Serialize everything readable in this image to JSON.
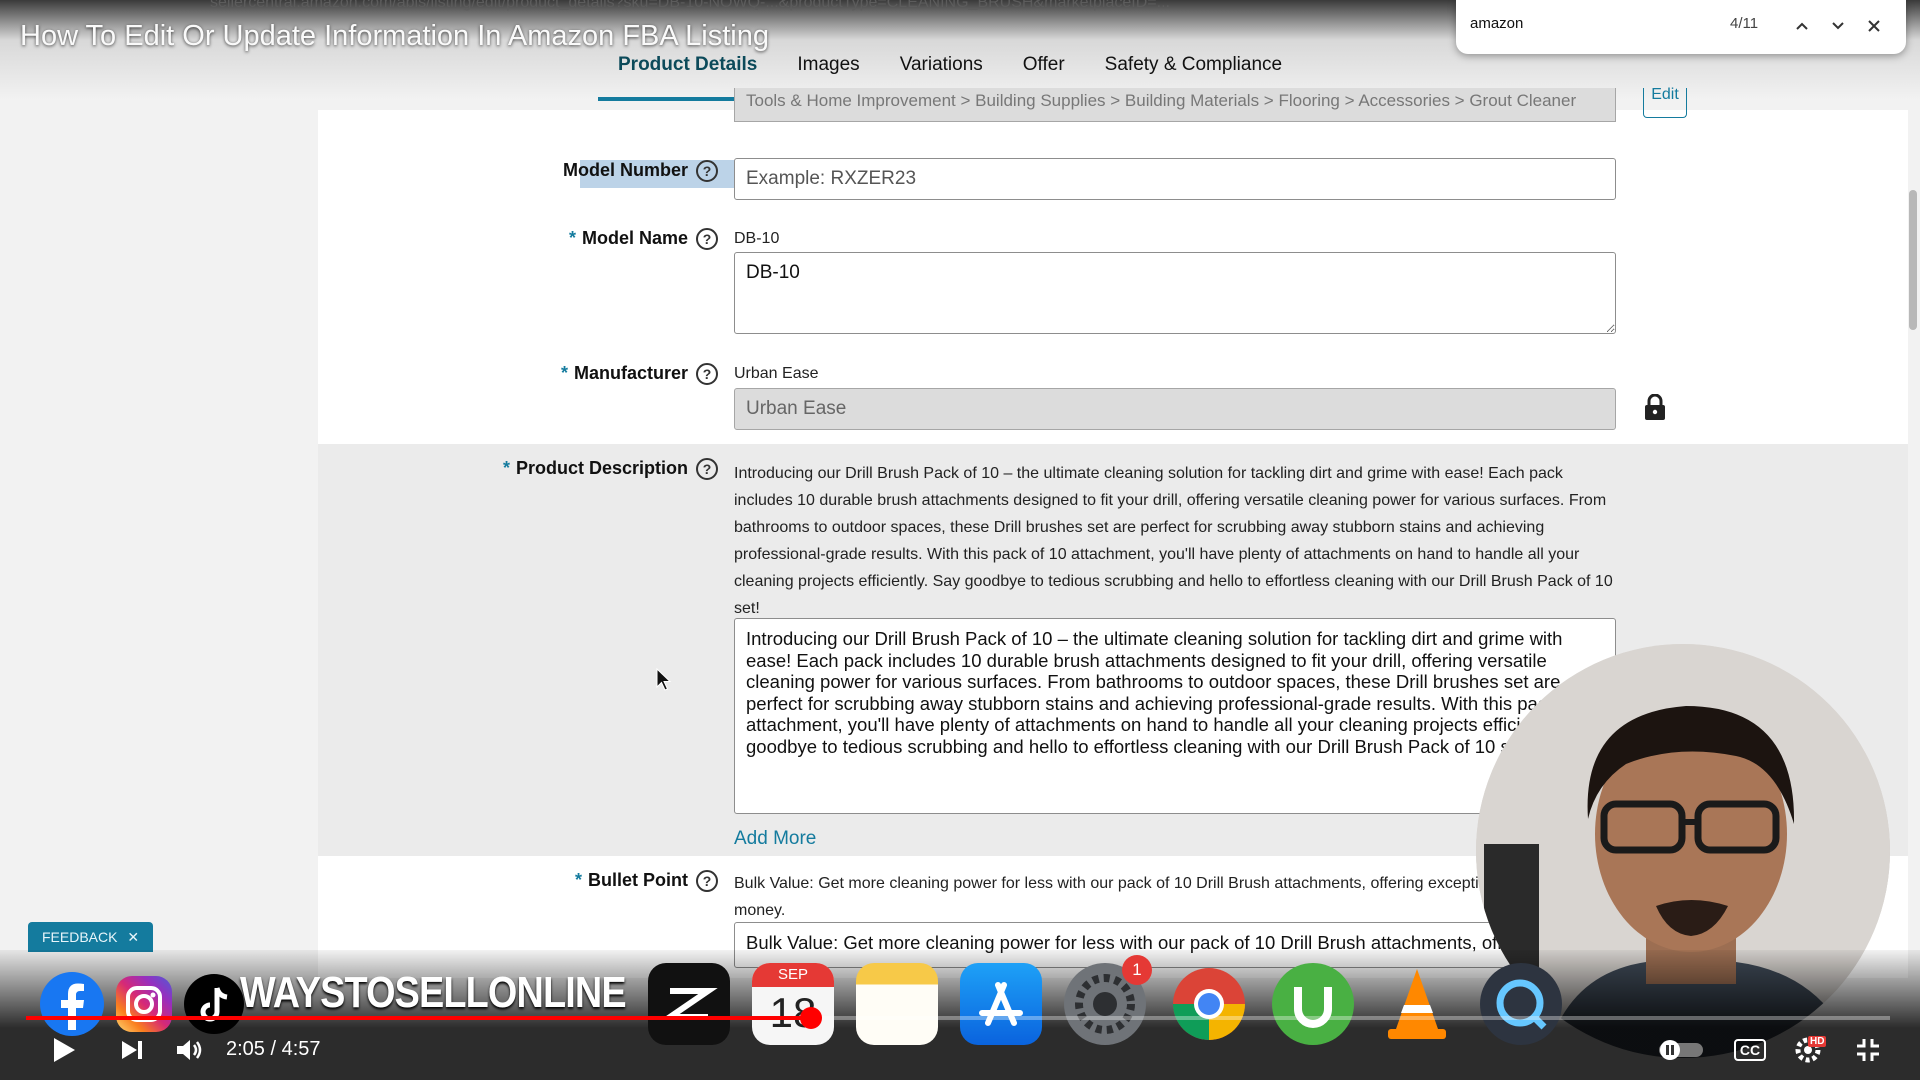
{
  "browser": {
    "url": "sellercentral.amazon.com/abis/listing/edit/product_details?sku=DB-10-NOWQ-...&productType=CLEANING_BRUSH&marketplaceID=..."
  },
  "video": {
    "title": "How To Edit Or Update Information In Amazon FBA Listing",
    "current_time": "2:05",
    "duration": "4:57",
    "time_display": "2:05 / 4:57",
    "progress": 0.4209
  },
  "find_bar": {
    "query": "amazon",
    "match_count": "4/11"
  },
  "tabs": [
    {
      "label": "Product Details",
      "active": true
    },
    {
      "label": "Images",
      "active": false
    },
    {
      "label": "Variations",
      "active": false
    },
    {
      "label": "Offer",
      "active": false
    },
    {
      "label": "Safety & Compliance",
      "active": false
    }
  ],
  "category": {
    "path": "Tools & Home Improvement > Building Supplies > Building Materials > Flooring > Accessories > Grout Cleaner",
    "edit_label": "Edit"
  },
  "form": {
    "model_number": {
      "label": "Model Number",
      "required": false,
      "placeholder": "Example: RXZER23",
      "value": ""
    },
    "model_name": {
      "label": "Model Name",
      "required": true,
      "caption": "DB-10",
      "value": "DB-10"
    },
    "manufacturer": {
      "label": "Manufacturer",
      "required": true,
      "caption": "Urban Ease",
      "value": "Urban Ease",
      "locked": true
    },
    "product_description": {
      "label": "Product Description",
      "required": true,
      "caption": "Introducing our Drill Brush Pack of 10 – the ultimate cleaning solution for tackling dirt and grime with ease! Each pack includes 10 durable brush attachments designed to fit your drill, offering versatile cleaning power for various surfaces. From bathrooms to outdoor spaces, these Drill brushes set are perfect for scrubbing away stubborn stains and achieving professional-grade results. With this pack of 10 attachment, you'll have plenty of attachments on hand to handle all your cleaning projects efficiently. Say goodbye to tedious scrubbing and hello to effortless cleaning with our Drill Brush Pack of 10 set!",
      "value": "Introducing our Drill Brush Pack of 10 – the ultimate cleaning solution for tackling dirt and grime with ease! Each pack includes 10 durable brush attachments designed to fit your drill, offering versatile cleaning power for various surfaces. From bathrooms to outdoor spaces, these Drill brushes set are perfect for scrubbing away stubborn stains and achieving professional-grade results. With this pack of 10 attachment, you'll have plenty of attachments on hand to handle all your cleaning projects efficiently. Say goodbye to tedious scrubbing and hello to effortless cleaning with our Drill Brush Pack of 10 set!",
      "add_more": "Add More"
    },
    "bullet_point": {
      "label": "Bullet Point",
      "required": true,
      "caption": "Bulk Value: Get more cleaning power for less with our pack of 10 Drill Brush attachments, offering exceptional value for money.",
      "value": "Bulk Value: Get more cleaning power for less with our pack of 10 Drill Brush attachments, offering exceptional value for money."
    }
  },
  "feedback": {
    "label": "FEEDBACK",
    "close": "✕"
  },
  "dock": {
    "brand_text": "WAYSTOSELLONLINE",
    "calendar_month": "SEP",
    "calendar_day": "18",
    "settings_badge": "1",
    "icons": [
      "facebook-icon",
      "instagram-icon",
      "tiktok-icon",
      "capcut-icon",
      "calendar-icon",
      "notes-icon",
      "app-store-icon",
      "system-settings-icon",
      "chrome-icon",
      "utorrent-icon",
      "vlc-icon",
      "quicktime-icon"
    ]
  },
  "player": {
    "hd_badge": "HD",
    "cc_label": "CC"
  },
  "colors": {
    "accent": "#147b9e",
    "progress": "#ff0000",
    "required_star": "#147b9e"
  }
}
